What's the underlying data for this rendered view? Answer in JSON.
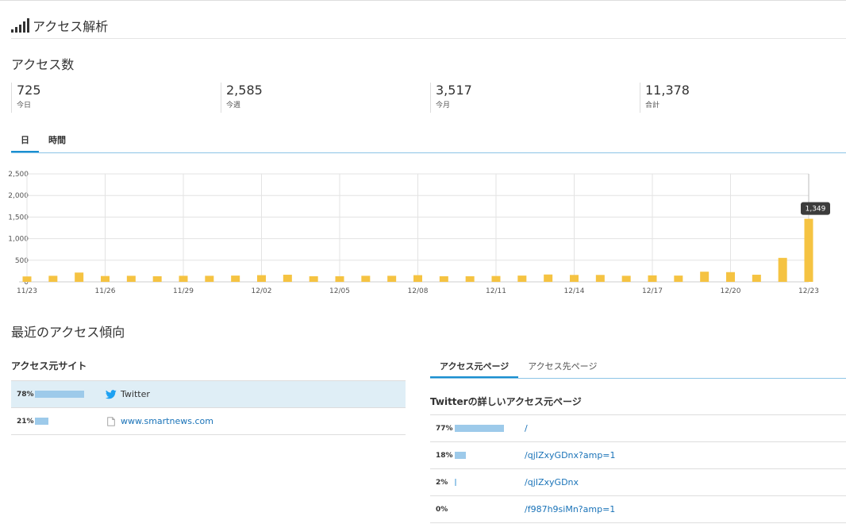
{
  "header": {
    "title": "アクセス解析",
    "icon": "signal-bars-icon"
  },
  "access_count": {
    "title": "アクセス数",
    "stats": [
      {
        "value": "725",
        "label": "今日"
      },
      {
        "value": "2,585",
        "label": "今週"
      },
      {
        "value": "3,517",
        "label": "今月"
      },
      {
        "value": "11,378",
        "label": "合計"
      }
    ]
  },
  "chart_tabs": [
    {
      "label": "日",
      "active": true
    },
    {
      "label": "時間",
      "active": false
    }
  ],
  "colors": {
    "bar": "#f5c342",
    "accent": "#1a8fd0",
    "link": "#1a73b8",
    "ref_bar": "#9dcaea",
    "selected_row": "#dfeef6"
  },
  "chart_data": {
    "type": "bar",
    "categories": [
      "11/23",
      "11/24",
      "11/25",
      "11/26",
      "11/27",
      "11/28",
      "11/29",
      "11/30",
      "12/01",
      "12/02",
      "12/03",
      "12/04",
      "12/05",
      "12/06",
      "12/07",
      "12/08",
      "12/09",
      "12/10",
      "12/11",
      "12/12",
      "12/13",
      "12/14",
      "12/15",
      "12/16",
      "12/17",
      "12/18",
      "12/19",
      "12/20",
      "12/21",
      "12/22",
      "12/23"
    ],
    "values": [
      125,
      140,
      215,
      135,
      140,
      130,
      140,
      140,
      145,
      155,
      165,
      130,
      130,
      140,
      140,
      155,
      130,
      130,
      135,
      145,
      170,
      160,
      160,
      140,
      150,
      145,
      235,
      225,
      165,
      555,
      1460
    ],
    "x_tick_labels": [
      "11/23",
      "11/26",
      "11/29",
      "12/02",
      "12/05",
      "12/08",
      "12/11",
      "12/14",
      "12/17",
      "12/20",
      "12/23"
    ],
    "y_ticks": [
      "0",
      "500",
      "1,000",
      "1,500",
      "2,000",
      "2,500"
    ],
    "ylim": [
      0,
      2500
    ],
    "tooltip": {
      "category": "12/23",
      "text": "1,349"
    },
    "grid": true,
    "title": "",
    "xlabel": "",
    "ylabel": ""
  },
  "recent": {
    "title": "最近のアクセス傾向"
  },
  "referrers": {
    "title": "アクセス元サイト",
    "rows": [
      {
        "pct": "78%",
        "ratio": 0.78,
        "icon": "twitter-bird-icon",
        "label": "Twitter",
        "selected": true
      },
      {
        "pct": "21%",
        "ratio": 0.21,
        "icon": "document-icon",
        "label": "www.smartnews.com",
        "selected": false
      }
    ]
  },
  "page_tabs": [
    {
      "label": "アクセス元ページ",
      "active": true
    },
    {
      "label": "アクセス先ページ",
      "active": false
    }
  ],
  "detail": {
    "title": "Twitterの詳しいアクセス元ページ",
    "rows": [
      {
        "pct": "77%",
        "ratio": 0.77,
        "link": "/"
      },
      {
        "pct": "18%",
        "ratio": 0.18,
        "link": "/qjIZxyGDnx?amp=1"
      },
      {
        "pct": "2%",
        "ratio": 0.02,
        "link": "/qjIZxyGDnx"
      },
      {
        "pct": "0%",
        "ratio": 0.0,
        "link": "/f987h9siMn?amp=1"
      }
    ]
  }
}
